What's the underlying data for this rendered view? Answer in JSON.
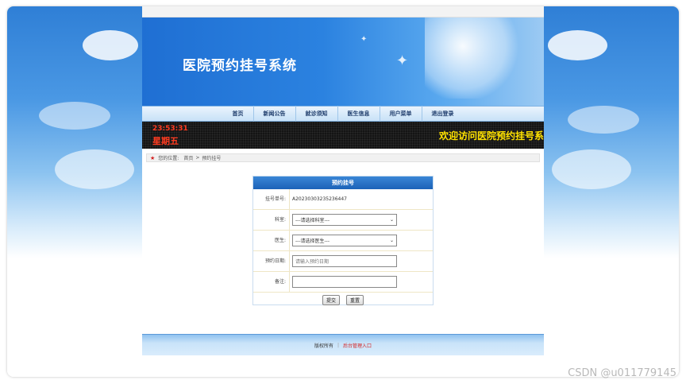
{
  "site": {
    "title": "医院预约挂号系统"
  },
  "nav": {
    "items": [
      {
        "label": "首页"
      },
      {
        "label": "新闻公告"
      },
      {
        "label": "就诊须知"
      },
      {
        "label": "医生信息"
      },
      {
        "label": "用户菜单"
      },
      {
        "label": "退出登录"
      }
    ]
  },
  "ticker": {
    "time": "23:53:31",
    "weekday": "星期五",
    "message": "欢迎访问医院预约挂号系"
  },
  "breadcrumb": {
    "prefix": "您的位置:",
    "home": "首页",
    "separator": ">",
    "current": "预约挂号"
  },
  "form": {
    "title": "预约挂号",
    "fields": {
      "order_no": {
        "label": "挂号单号:",
        "value": "A20230303235236447"
      },
      "department": {
        "label": "科室:",
        "selected": "---请选择科室---"
      },
      "doctor": {
        "label": "医生:",
        "selected": "---请选择医生---"
      },
      "date": {
        "label": "预约日期:",
        "placeholder": "请输入预约日期"
      },
      "remark": {
        "label": "备注:",
        "value": ""
      }
    },
    "buttons": {
      "submit": "提交",
      "reset": "重置"
    }
  },
  "footer": {
    "copyright": "版权所有",
    "separator": "|",
    "admin_link": "后台管理入口"
  },
  "watermark": "CSDN @u011779145",
  "colors": {
    "accent": "#1b62b8",
    "ticker_time": "#ff3b20",
    "ticker_text": "#ffe200",
    "admin_link": "#d42020"
  }
}
